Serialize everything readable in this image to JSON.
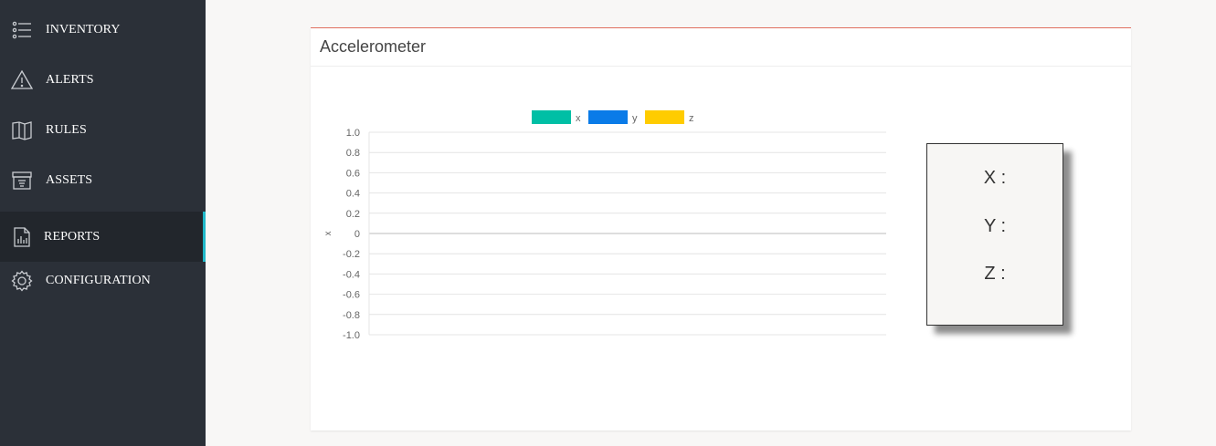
{
  "sidebar": {
    "items": [
      {
        "label": "INVENTORY",
        "icon": "list-icon"
      },
      {
        "label": "ALERTS",
        "icon": "warning-icon"
      },
      {
        "label": "RULES",
        "icon": "book-icon"
      },
      {
        "label": "ASSETS",
        "icon": "box-icon"
      },
      {
        "label": "REPORTS",
        "icon": "report-icon",
        "active": true
      },
      {
        "label": "CONFIGURATION",
        "icon": "gear-icon"
      }
    ]
  },
  "card": {
    "title": "Accelerometer"
  },
  "readout": {
    "x_label": "X :",
    "y_label": "Y :",
    "z_label": "Z :"
  },
  "chart_data": {
    "type": "line",
    "title": "",
    "xlabel": "",
    "ylabel": "x",
    "ylim": [
      -1.0,
      1.0
    ],
    "yticks": [
      "1.0",
      "0.8",
      "0.6",
      "0.4",
      "0.2",
      "0",
      "-0.2",
      "-0.4",
      "-0.6",
      "-0.8",
      "-1.0"
    ],
    "grid": true,
    "legend_position": "top",
    "series": [
      {
        "name": "x",
        "color": "#00bfa5",
        "values": []
      },
      {
        "name": "y",
        "color": "#0a7be8",
        "values": []
      },
      {
        "name": "z",
        "color": "#ffcc00",
        "values": []
      }
    ]
  }
}
